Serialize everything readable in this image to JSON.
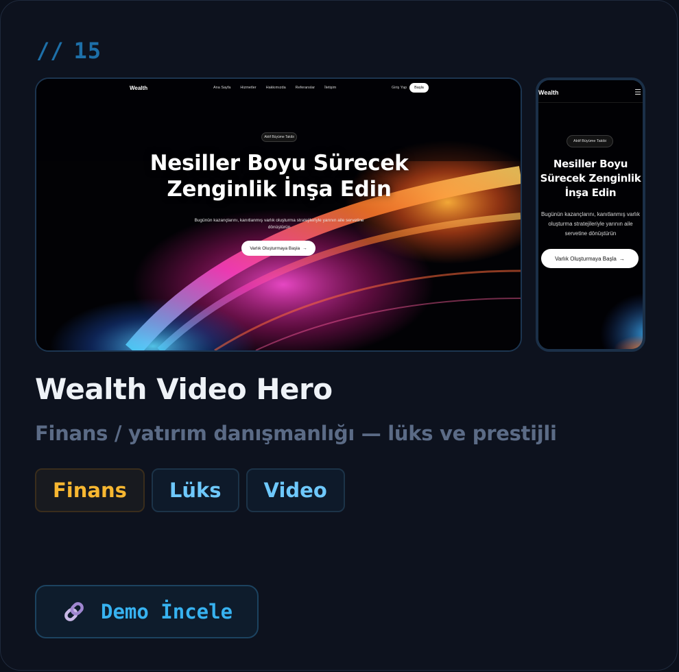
{
  "card": {
    "index_prefix": "//",
    "index_number": "15",
    "title": "Wealth Video Hero",
    "subtitle": "Finans / yatırım danışmanlığı — lüks ve prestijli",
    "tags": [
      {
        "label": "Finans",
        "color": "#f7b731"
      },
      {
        "label": "Lüks",
        "color": "#6ec8fb"
      },
      {
        "label": "Video",
        "color": "#6ec8fb"
      }
    ],
    "demo_button": {
      "label": "Demo İncele",
      "icon": "link-icon"
    }
  },
  "desktop_preview": {
    "logo": "Wealth",
    "nav_links": [
      "Ana Sayfa",
      "Hizmetler",
      "Hakkımızda",
      "Referanslar",
      "İletişim"
    ],
    "login": "Giriş Yap",
    "start": "Başla",
    "badge": "Aktif Büyüme Takibi",
    "headline_line1": "Nesiller Boyu Sürecek",
    "headline_line2": "Zenginlik İnşa Edin",
    "subtext": "Bugünün kazançlarını, kanıtlanmış varlık oluşturma stratejileriyle yarının aile servetine dönüştürün",
    "cta": "Varlık Oluşturmaya Başla",
    "cta_icon": "arrow-right-icon"
  },
  "mobile_preview": {
    "logo": "Wealth",
    "menu_icon": "hamburger-menu-icon",
    "badge": "Aktif Büyüme Takibi",
    "headline": "Nesiller Boyu Sürecek Zenginlik İnşa Edin",
    "subtext": "Bugünün kazançlarını, kanıtlanmış varlık oluşturma stratejileriyle yarının aile servetine dönüştürün",
    "cta": "Varlık Oluşturmaya Başla"
  }
}
